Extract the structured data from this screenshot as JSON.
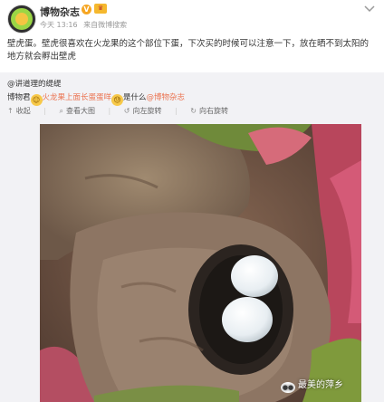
{
  "post": {
    "username": "博物杂志",
    "v_badge": "V",
    "time": "今天 13:16",
    "source_prefix": "来自",
    "source": "微博搜索",
    "text": "壁虎蛋。壁虎很喜欢在火龙果的这个部位下蛋，下次买的时候可以注意一下，放在晒不到太阳的地方就会孵出壁虎"
  },
  "repost": {
    "author": "@讲道理的缇缇",
    "mention_prefix": "博物君",
    "question": "火龙果上面长蛋蛋咩",
    "question_suffix": "是什么",
    "mention": "@博物杂志",
    "tools": [
      {
        "icon": "collapse-icon",
        "label": "收起"
      },
      {
        "icon": "zoom-icon",
        "label": "查看大图"
      },
      {
        "icon": "rotate-left-icon",
        "label": "向左旋转"
      },
      {
        "icon": "rotate-right-icon",
        "label": "向右旋转"
      }
    ]
  },
  "photo": {
    "watermark": "最美的萍乡"
  },
  "colors": {
    "link": "#eb7350",
    "repost_bg": "#f2f2f5",
    "badge": "#f6a623"
  }
}
